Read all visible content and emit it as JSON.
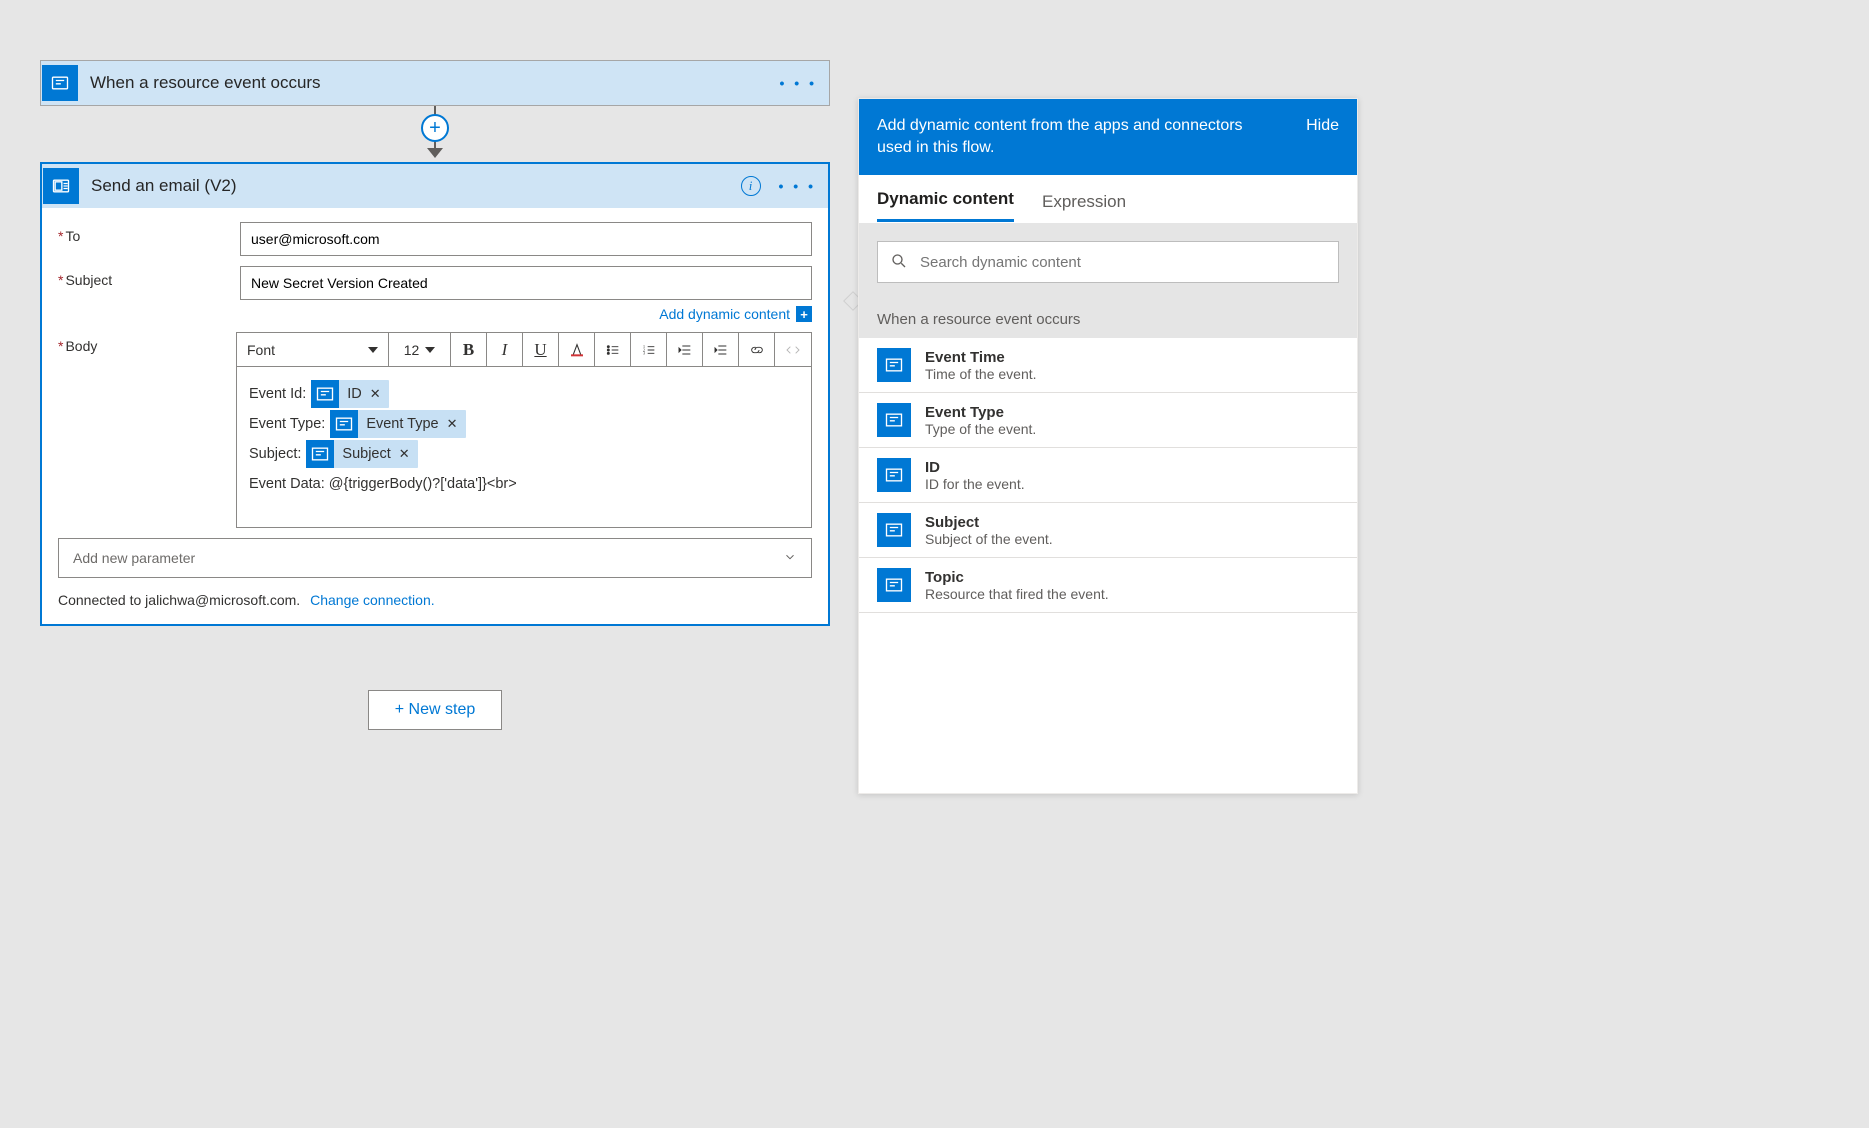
{
  "trigger": {
    "title": "When a resource event occurs"
  },
  "action": {
    "title": "Send an email (V2)",
    "fields": {
      "to_label": "To",
      "to_value": "user@microsoft.com",
      "subject_label": "Subject",
      "subject_value": "New Secret Version Created",
      "body_label": "Body"
    },
    "add_dynamic_content": "Add dynamic content",
    "toolbar": {
      "font": "Font",
      "size": "12"
    },
    "body_lines": {
      "l1_label": "Event Id:",
      "l1_token": "ID",
      "l2_label": "Event Type:",
      "l2_token": "Event Type",
      "l3_label": "Subject:",
      "l3_token": "Subject",
      "l4": "Event Data: @{triggerBody()?['data']}<br>"
    },
    "add_param": "Add new parameter",
    "connected": "Connected to jalichwa@microsoft.com.",
    "change_conn": "Change connection."
  },
  "new_step": "+ New step",
  "panel": {
    "head": "Add dynamic content from the apps and connectors used in this flow.",
    "hide": "Hide",
    "tab_dynamic": "Dynamic content",
    "tab_expression": "Expression",
    "search_placeholder": "Search dynamic content",
    "group": "When a resource event occurs",
    "items": [
      {
        "label": "Event Time",
        "desc": "Time of the event."
      },
      {
        "label": "Event Type",
        "desc": "Type of the event."
      },
      {
        "label": "ID",
        "desc": "ID for the event."
      },
      {
        "label": "Subject",
        "desc": "Subject of the event."
      },
      {
        "label": "Topic",
        "desc": "Resource that fired the event."
      }
    ]
  }
}
